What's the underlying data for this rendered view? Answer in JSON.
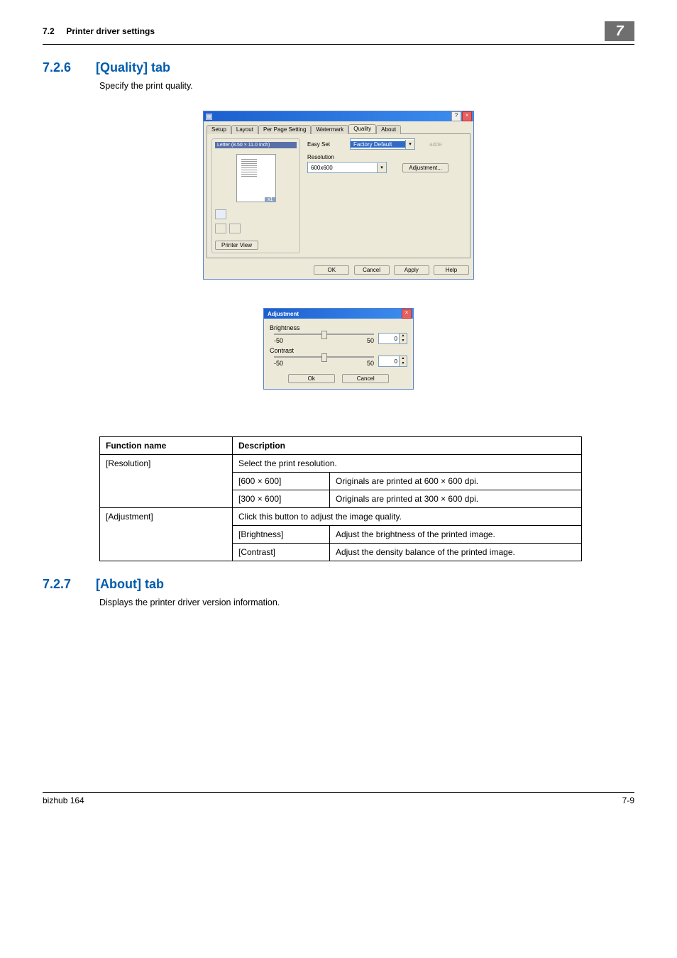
{
  "header": {
    "section": "7.2",
    "title": "Printer driver settings",
    "chapter": "7"
  },
  "sect1": {
    "num": "7.2.6",
    "title": "[Quality] tab",
    "body": "Specify the print quality."
  },
  "dlg1": {
    "tabs": [
      "Setup",
      "Layout",
      "Per Page Setting",
      "Watermark",
      "Quality",
      "About"
    ],
    "preview_paper": "Letter (8.50 × 11.0 Inch)",
    "x1": "x1",
    "printer_view": "Printer View",
    "easy_set_label": "Easy Set",
    "easy_set_value": "Factory Default",
    "adde": "adde",
    "resolution_label": "Resolution",
    "resolution_value": "600x600",
    "adjustment_btn": "Adjustment...",
    "ok": "OK",
    "cancel": "Cancel",
    "apply": "Apply",
    "help": "Help"
  },
  "dlg2": {
    "title": "Adjustment",
    "brightness_label": "Brightness",
    "brightness_min": "-50",
    "brightness_max": "50",
    "brightness_val": "0",
    "contrast_label": "Contrast",
    "contrast_min": "-50",
    "contrast_max": "50",
    "contrast_val": "0",
    "ok": "Ok",
    "cancel": "Cancel"
  },
  "table": {
    "head_fn": "Function name",
    "head_desc": "Description",
    "rows": [
      {
        "fn": "[Resolution]",
        "desc": "Select the print resolution.",
        "subs": [
          {
            "k": "[600 × 600]",
            "v": "Originals are printed at 600 × 600 dpi."
          },
          {
            "k": "[300 × 600]",
            "v": "Originals are printed at 300 × 600 dpi."
          }
        ]
      },
      {
        "fn": "[Adjustment]",
        "desc": "Click this button to adjust the image quality.",
        "subs": [
          {
            "k": "[Brightness]",
            "v": "Adjust the brightness of the printed image."
          },
          {
            "k": "[Contrast]",
            "v": "Adjust the density balance of the printed image."
          }
        ]
      }
    ]
  },
  "sect2": {
    "num": "7.2.7",
    "title": "[About] tab",
    "body": "Displays the printer driver version information."
  },
  "footer": {
    "left": "bizhub 164",
    "right": "7-9"
  }
}
